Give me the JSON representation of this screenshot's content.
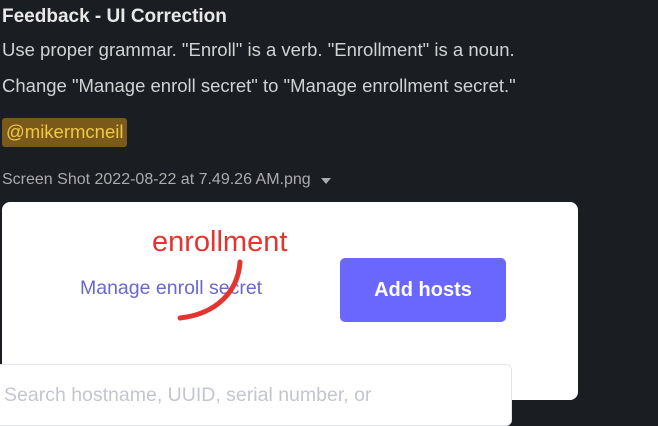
{
  "message": {
    "title": "Feedback - UI Correction",
    "line1": "Use proper grammar. \"Enroll\" is a verb. \"Enrollment\" is a noun.",
    "line2": "Change \"Manage enroll secret\" to \"Manage enrollment secret.\"",
    "mention": "@mikermcneil"
  },
  "attachment": {
    "filename": "Screen Shot 2022-08-22 at 7.49.26 AM.png",
    "preview": {
      "manage_link": "Manage enroll secret",
      "add_button": "Add hosts",
      "correction": "enrollment",
      "search_placeholder": "Search hostname, UUID, serial number, or"
    }
  },
  "colors": {
    "background": "#1a1d21",
    "mention_bg": "#7a5a1a",
    "mention_text": "#f2c744",
    "link": "#6a67ce",
    "button": "#6a67fe",
    "correction": "#e3342f"
  }
}
